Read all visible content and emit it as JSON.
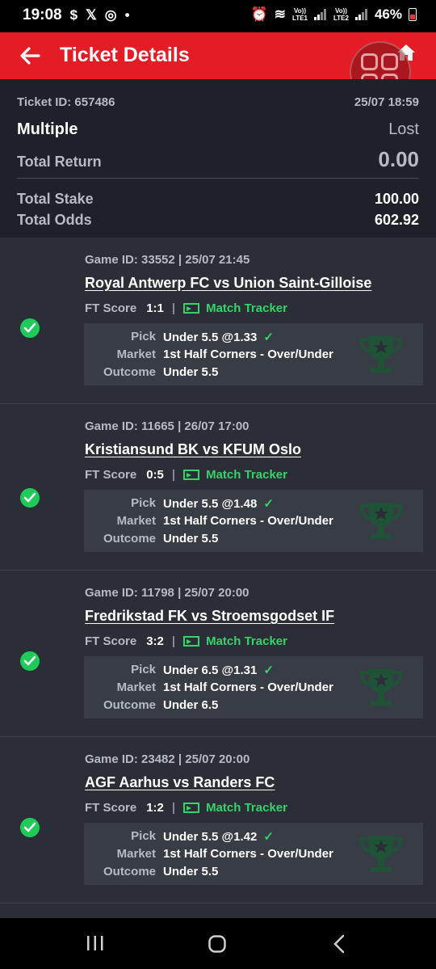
{
  "status_bar": {
    "time": "19:08",
    "left_icons": [
      "s-icon",
      "x-icon",
      "instagram-icon",
      "dot-icon"
    ],
    "sim1": "LTE1",
    "sim2": "LTE2",
    "vo_label": "Vo))",
    "battery": "46%"
  },
  "app_bar": {
    "title": "Ticket Details"
  },
  "summary": {
    "ticket_id": "Ticket ID: 657486",
    "date": "25/07 18:59",
    "bet_type": "Multiple",
    "status": "Lost",
    "total_return_label": "Total Return",
    "total_return": "0.00",
    "total_stake_label": "Total Stake",
    "total_stake": "100.00",
    "total_odds_label": "Total Odds",
    "total_odds": "602.92"
  },
  "labels": {
    "ft_score": "FT Score",
    "match_tracker": "Match Tracker",
    "pick": "Pick",
    "market": "Market",
    "outcome": "Outcome"
  },
  "legs": [
    {
      "game": "Game ID: 33552 | 25/07 21:45",
      "teams": "Royal Antwerp FC vs Union Saint-Gilloise",
      "score": "1:1",
      "pick": "Under 5.5 @1.33",
      "market": "1st Half Corners - Over/Under",
      "outcome": "Under 5.5"
    },
    {
      "game": "Game ID: 11665 | 26/07 17:00",
      "teams": "Kristiansund BK vs KFUM Oslo",
      "score": "0:5",
      "pick": "Under 5.5 @1.48",
      "market": "1st Half Corners - Over/Under",
      "outcome": "Under 5.5"
    },
    {
      "game": "Game ID: 11798 | 25/07 20:00",
      "teams": "Fredrikstad FK vs Stroemsgodset IF",
      "score": "3:2",
      "pick": "Under 6.5 @1.31",
      "market": "1st Half Corners - Over/Under",
      "outcome": "Under 6.5"
    },
    {
      "game": "Game ID: 23482 | 25/07 20:00",
      "teams": "AGF Aarhus vs Randers FC",
      "score": "1:2",
      "pick": "Under 5.5 @1.42",
      "market": "1st Half Corners - Over/Under",
      "outcome": "Under 5.5"
    }
  ],
  "colors": {
    "brand_red": "#e41c26",
    "win_green": "#1fca5a",
    "tracker_green": "#35d36a"
  }
}
